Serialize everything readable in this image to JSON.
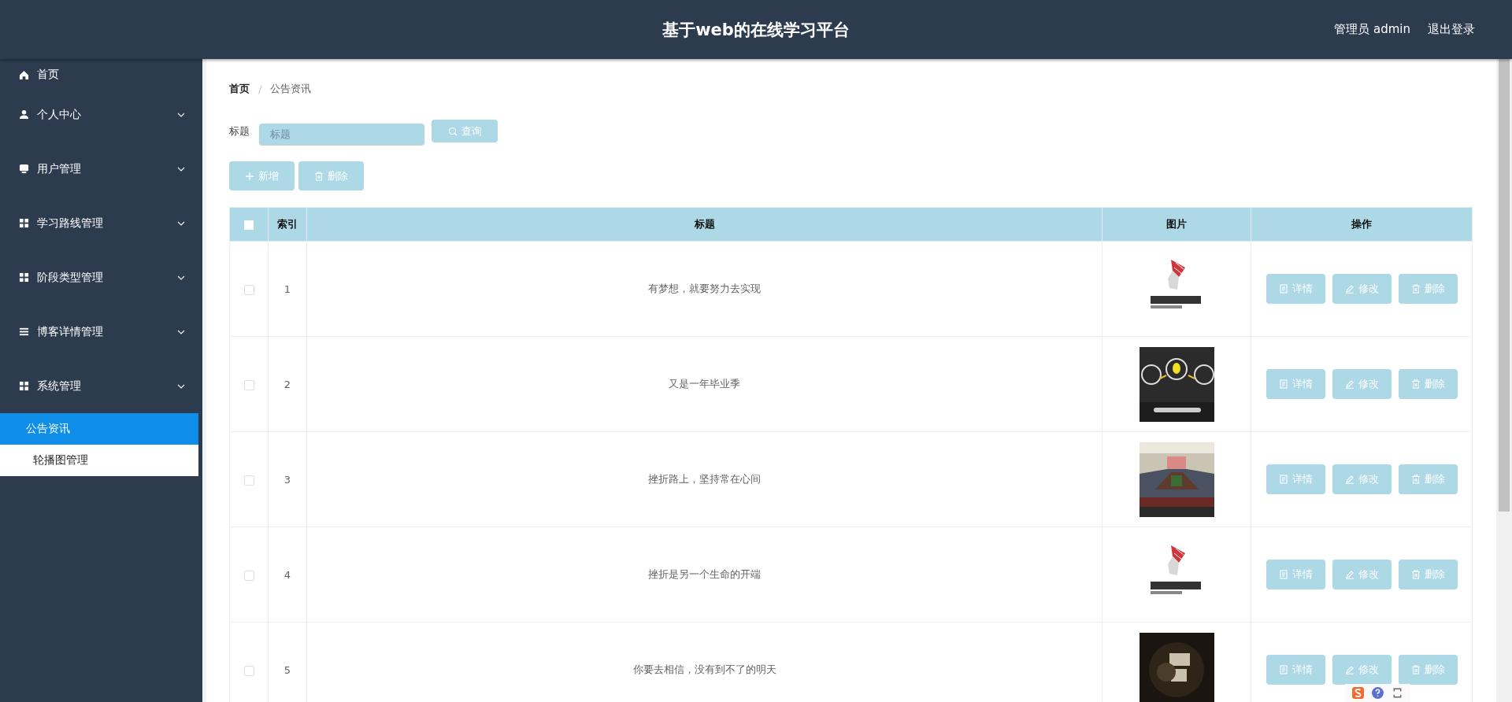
{
  "header": {
    "title": "基于web的在线学习平台",
    "user": "管理员 admin",
    "logout": "退出登录"
  },
  "sidebar": {
    "items": [
      {
        "label": "首页",
        "kind": "home"
      },
      {
        "label": "个人中心",
        "kind": "user",
        "submenu": true
      },
      {
        "label": "用户管理",
        "kind": "monitor",
        "submenu": true
      },
      {
        "label": "学习路线管理",
        "kind": "grid",
        "submenu": true
      },
      {
        "label": "阶段类型管理",
        "kind": "grid",
        "submenu": true
      },
      {
        "label": "博客详情管理",
        "kind": "list",
        "submenu": true
      },
      {
        "label": "系统管理",
        "kind": "grid",
        "submenu": true,
        "children": [
          {
            "label": "公告资讯",
            "selected": true
          },
          {
            "label": "轮播图管理",
            "selected": false
          }
        ]
      }
    ]
  },
  "breadcrumb": {
    "separator": "/",
    "items": [
      {
        "label": "首页"
      },
      {
        "label": "公告资讯"
      }
    ]
  },
  "search": {
    "label": "标题",
    "placeholder": "标题",
    "button": "查询"
  },
  "toolbar": [
    {
      "label": "新增",
      "kind": "add"
    },
    {
      "label": "删除",
      "kind": "delete"
    }
  ],
  "table": {
    "select_all_checked": false,
    "columns": [
      "索引",
      "标题",
      "图片",
      "操作"
    ],
    "rows": [
      {
        "checked": false,
        "index": "1",
        "title": "有梦想，就要努力去实现",
        "actions": [
          {
            "label": "详情",
            "kind": "detail"
          },
          {
            "label": "修改",
            "kind": "edit"
          },
          {
            "label": "删除",
            "kind": "delete"
          }
        ]
      },
      {
        "checked": false,
        "index": "2",
        "title": "又是一年毕业季",
        "actions": [
          {
            "label": "详情",
            "kind": "detail"
          },
          {
            "label": "修改",
            "kind": "edit"
          },
          {
            "label": "删除",
            "kind": "delete"
          }
        ]
      },
      {
        "checked": false,
        "index": "3",
        "title": "挫折路上，坚持常在心间",
        "actions": [
          {
            "label": "详情",
            "kind": "detail"
          },
          {
            "label": "修改",
            "kind": "edit"
          },
          {
            "label": "删除",
            "kind": "delete"
          }
        ]
      },
      {
        "checked": false,
        "index": "4",
        "title": "挫折是另一个生命的开端",
        "actions": [
          {
            "label": "详情",
            "kind": "detail"
          },
          {
            "label": "修改",
            "kind": "edit"
          },
          {
            "label": "删除",
            "kind": "delete"
          }
        ]
      },
      {
        "checked": false,
        "index": "5",
        "title": "你要去相信，没有到不了的明天",
        "actions": [
          {
            "label": "详情",
            "kind": "detail"
          },
          {
            "label": "修改",
            "kind": "edit"
          },
          {
            "label": "删除",
            "kind": "delete"
          }
        ]
      }
    ]
  }
}
